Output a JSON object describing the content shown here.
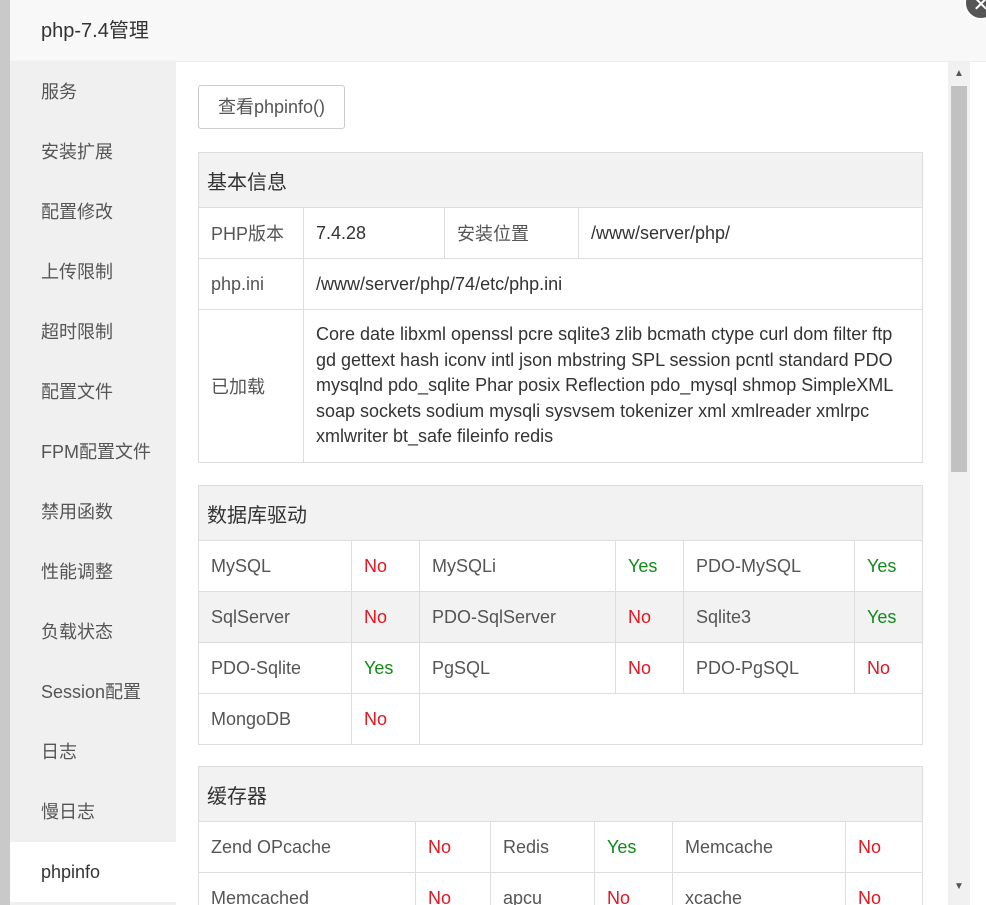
{
  "window": {
    "title": "php-7.4管理"
  },
  "sidebar": {
    "items": [
      {
        "label": "服务"
      },
      {
        "label": "安装扩展"
      },
      {
        "label": "配置修改"
      },
      {
        "label": "上传限制"
      },
      {
        "label": "超时限制"
      },
      {
        "label": "配置文件"
      },
      {
        "label": "FPM配置文件"
      },
      {
        "label": "禁用函数"
      },
      {
        "label": "性能调整"
      },
      {
        "label": "负载状态"
      },
      {
        "label": "Session配置"
      },
      {
        "label": "日志"
      },
      {
        "label": "慢日志"
      },
      {
        "label": "phpinfo"
      }
    ],
    "active": "phpinfo"
  },
  "toolbar": {
    "phpinfo_button": "查看phpinfo()"
  },
  "basic": {
    "title": "基本信息",
    "php_version_label": "PHP版本",
    "php_version": "7.4.28",
    "install_path_label": "安装位置",
    "install_path": "/www/server/php/",
    "ini_label": "php.ini",
    "ini_path": "/www/server/php/74/etc/php.ini",
    "loaded_label": "已加载",
    "loaded": "Core date libxml openssl pcre sqlite3 zlib bcmath ctype curl dom filter ftp gd gettext hash iconv intl json mbstring SPL session pcntl standard PDO mysqlnd pdo_sqlite Phar posix Reflection pdo_mysql shmop SimpleXML soap sockets sodium mysqli sysvsem tokenizer xml xmlreader xmlrpc xmlwriter bt_safe fileinfo redis"
  },
  "db": {
    "title": "数据库驱动",
    "rows": [
      [
        {
          "name": "MySQL",
          "status": "No"
        },
        {
          "name": "MySQLi",
          "status": "Yes"
        },
        {
          "name": "PDO-MySQL",
          "status": "Yes"
        }
      ],
      [
        {
          "name": "SqlServer",
          "status": "No"
        },
        {
          "name": "PDO-SqlServer",
          "status": "No"
        },
        {
          "name": "Sqlite3",
          "status": "Yes"
        }
      ],
      [
        {
          "name": "PDO-Sqlite",
          "status": "Yes"
        },
        {
          "name": "PgSQL",
          "status": "No"
        },
        {
          "name": "PDO-PgSQL",
          "status": "No"
        }
      ],
      [
        {
          "name": "MongoDB",
          "status": "No"
        }
      ]
    ]
  },
  "cache": {
    "title": "缓存器",
    "rows": [
      [
        {
          "name": "Zend OPcache",
          "status": "No"
        },
        {
          "name": "Redis",
          "status": "Yes"
        },
        {
          "name": "Memcache",
          "status": "No"
        }
      ],
      [
        {
          "name": "Memcached",
          "status": "No"
        },
        {
          "name": "apcu",
          "status": "No"
        },
        {
          "name": "xcache",
          "status": "No"
        }
      ]
    ]
  }
}
